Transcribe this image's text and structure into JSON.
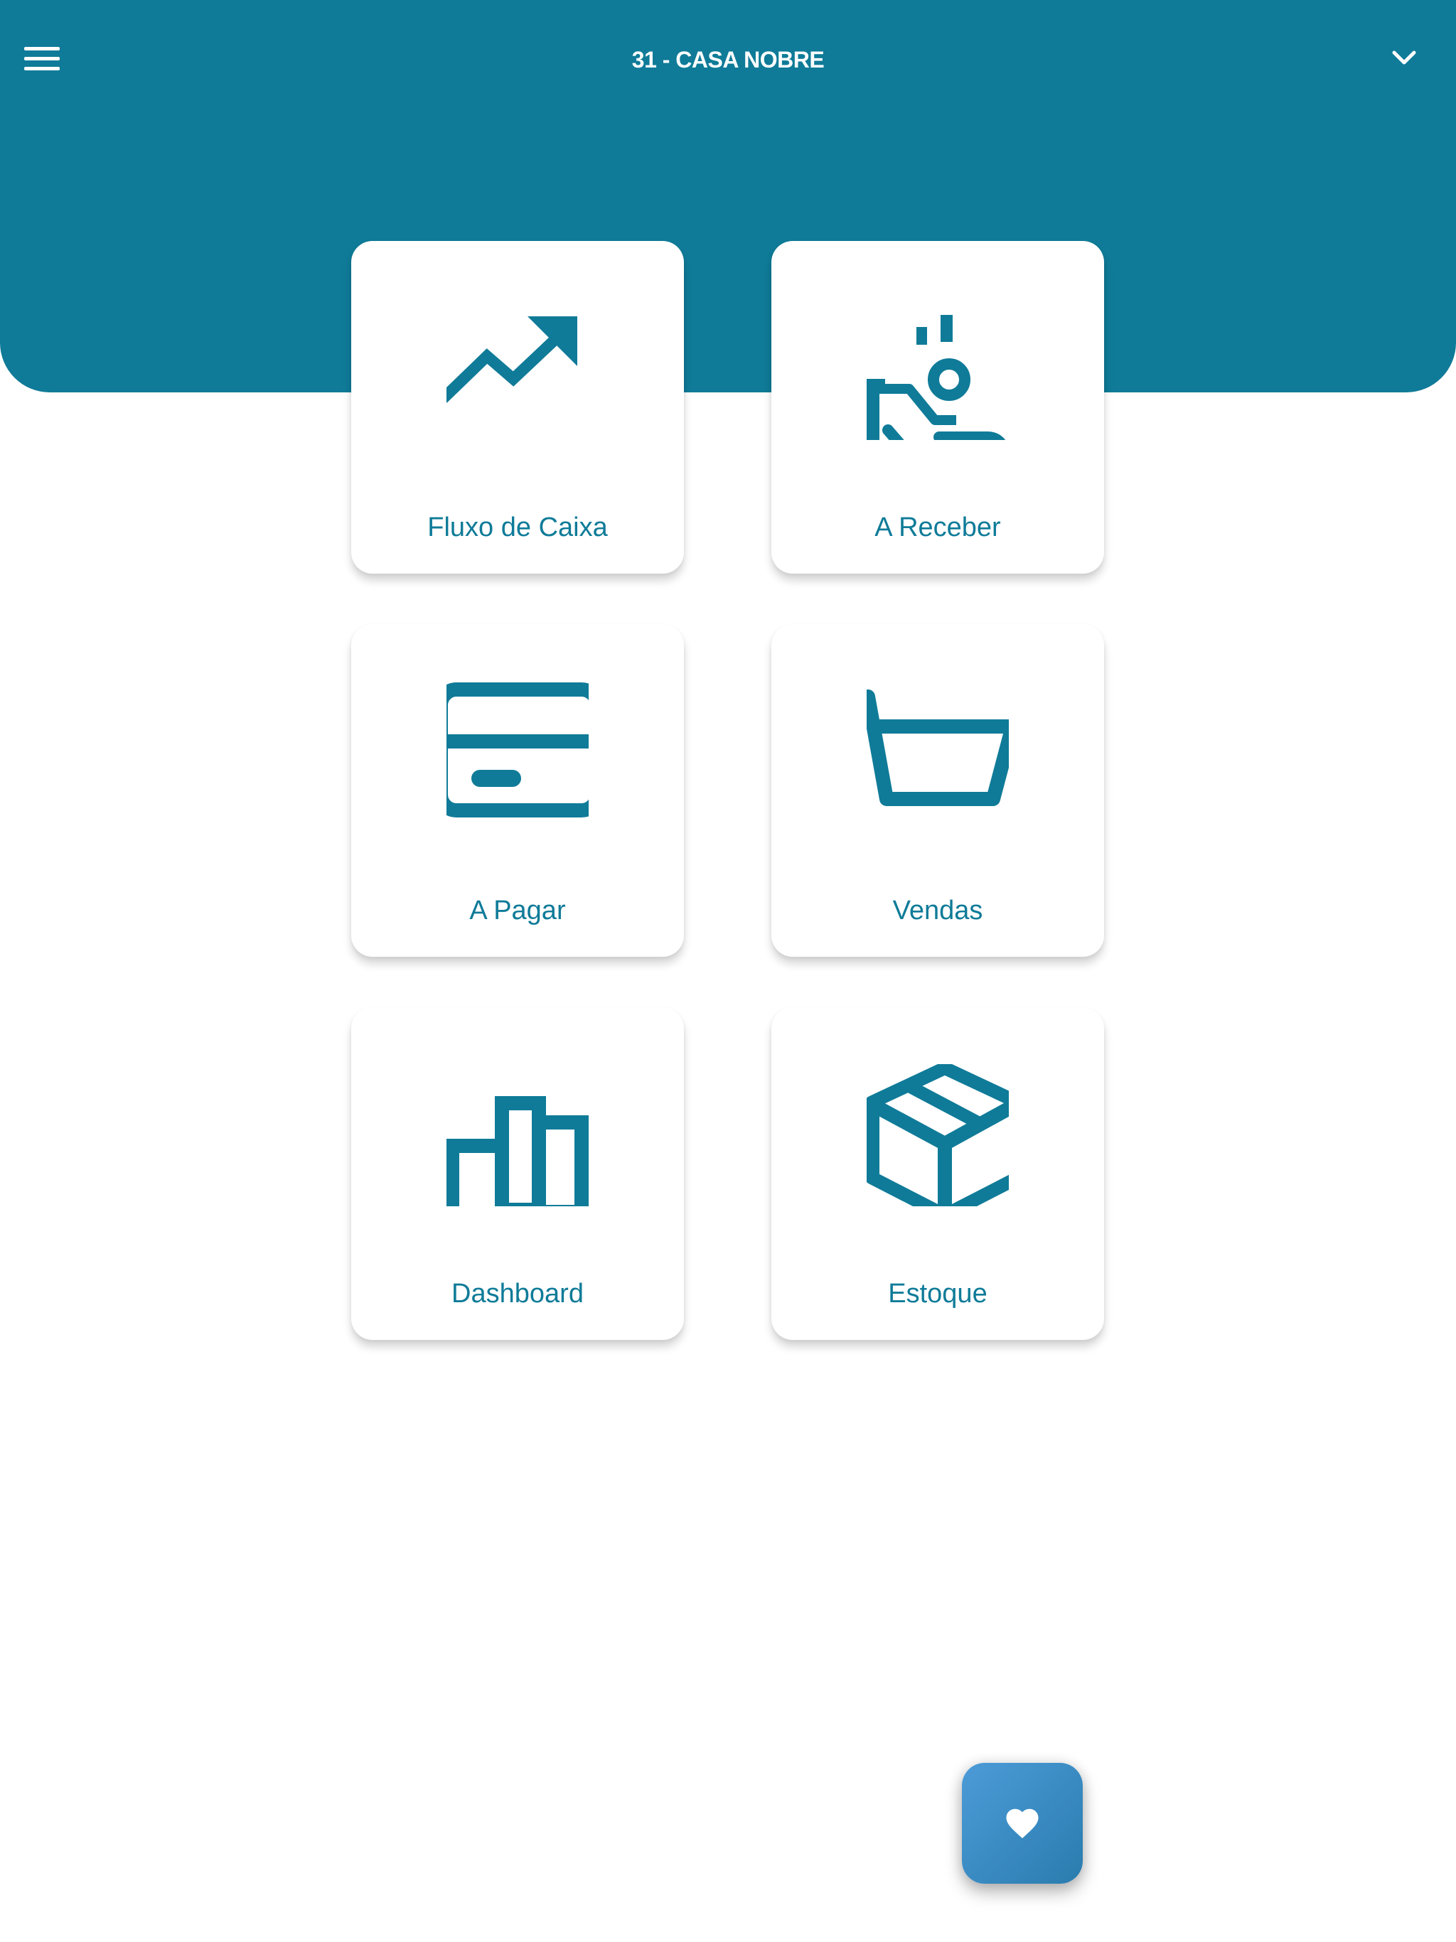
{
  "header": {
    "title": "31 - CASA NOBRE",
    "menu_icon": "hamburger-menu-icon",
    "dropdown_icon": "chevron-down-icon",
    "background_color": "#0f7b98"
  },
  "cards": [
    {
      "label": "Fluxo de Caixa",
      "icon": "trending-up-icon"
    },
    {
      "label": "A Receber",
      "icon": "hand-coin-icon"
    },
    {
      "label": "A Pagar",
      "icon": "credit-card-icon"
    },
    {
      "label": "Vendas",
      "icon": "shopping-cart-icon"
    },
    {
      "label": "Dashboard",
      "icon": "bar-chart-icon"
    },
    {
      "label": "Estoque",
      "icon": "package-box-icon"
    }
  ],
  "accent_color": "#0f7b98",
  "fab": {
    "icon": "heart-icon",
    "gradient": [
      "#4c9bd8",
      "#2a7cae"
    ]
  }
}
